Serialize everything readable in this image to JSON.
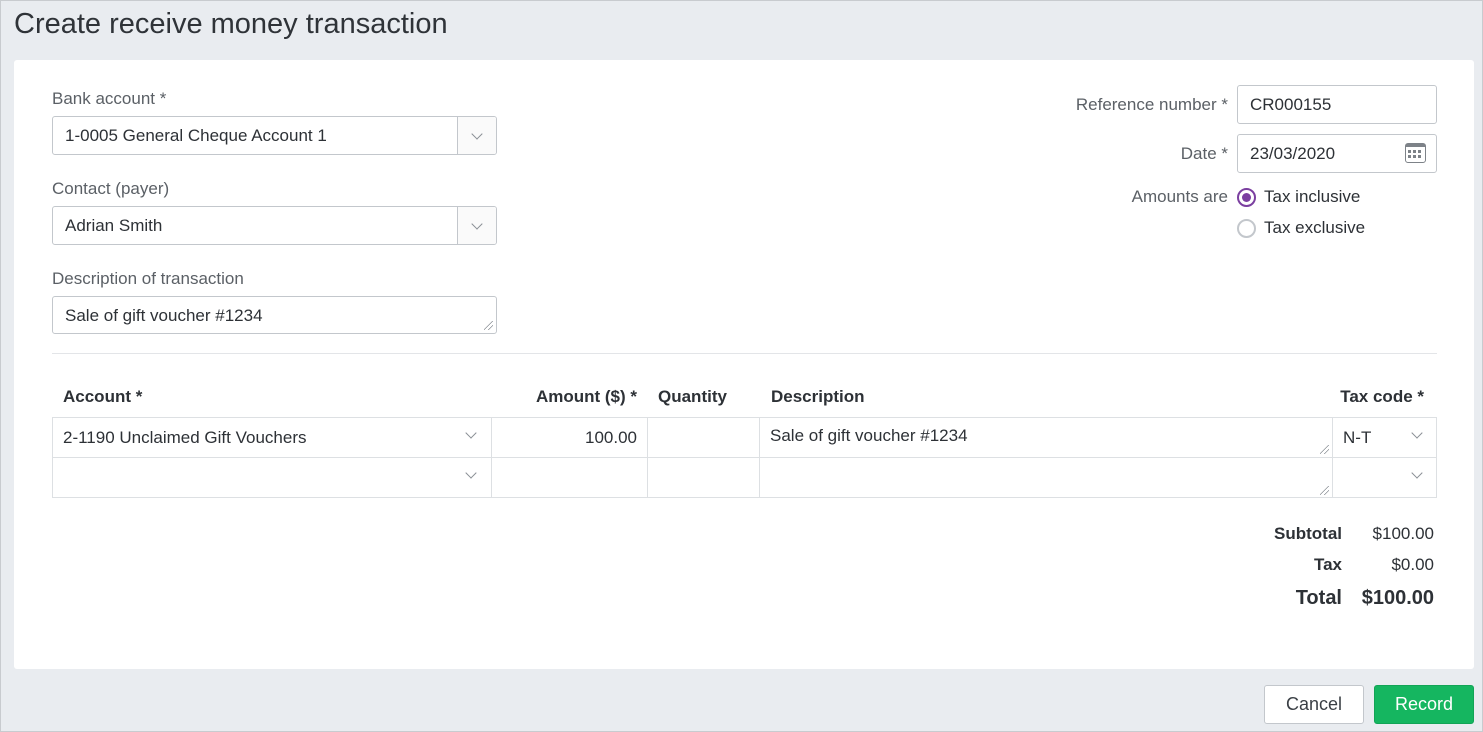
{
  "page": {
    "title": "Create receive money transaction"
  },
  "form": {
    "bank_account": {
      "label": "Bank account *",
      "value": "1-0005 General Cheque Account 1"
    },
    "contact": {
      "label": "Contact (payer)",
      "value": "Adrian Smith"
    },
    "description": {
      "label": "Description of transaction",
      "value": "Sale of gift voucher #1234"
    },
    "reference": {
      "label": "Reference number *",
      "value": "CR000155"
    },
    "date": {
      "label": "Date *",
      "value": "23/03/2020"
    },
    "amounts_are": {
      "label": "Amounts are",
      "options": [
        {
          "label": "Tax inclusive",
          "selected": true
        },
        {
          "label": "Tax exclusive",
          "selected": false
        }
      ]
    }
  },
  "table": {
    "headers": {
      "account": "Account *",
      "amount": "Amount ($) *",
      "quantity": "Quantity",
      "description": "Description",
      "tax_code": "Tax code *"
    },
    "rows": [
      {
        "account": "2-1190 Unclaimed Gift Vouchers",
        "amount": "100.00",
        "quantity": "",
        "description": "Sale of gift voucher #1234",
        "tax_code": "N-T"
      },
      {
        "account": "",
        "amount": "",
        "quantity": "",
        "description": "",
        "tax_code": ""
      }
    ]
  },
  "totals": {
    "subtotal_label": "Subtotal",
    "subtotal": "$100.00",
    "tax_label": "Tax",
    "tax": "$0.00",
    "total_label": "Total",
    "total": "$100.00"
  },
  "actions": {
    "cancel": "Cancel",
    "record": "Record"
  },
  "colors": {
    "accent": "#7b3fa0",
    "primary_button": "#15b660",
    "background": "#e9ecf0"
  },
  "icons": {
    "select": "chevron-down-icon",
    "date": "calendar-icon"
  }
}
